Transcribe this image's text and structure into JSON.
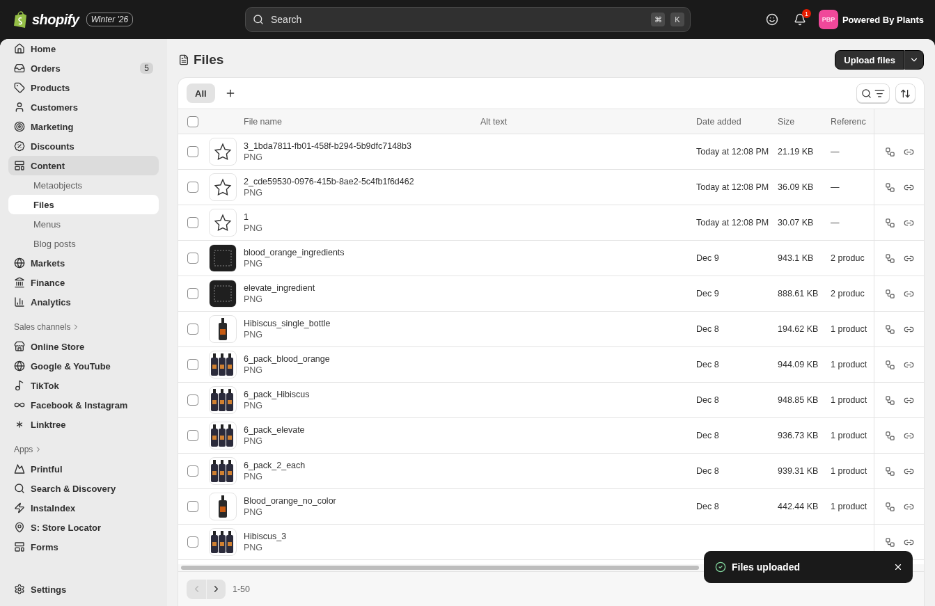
{
  "topbar": {
    "brand": "shopify",
    "edition": "Winter '26",
    "search": {
      "placeholder": "Search",
      "keys": [
        "⌘",
        "K"
      ]
    },
    "notifications": "1",
    "store": {
      "initials": "PBP",
      "name": "Powered By Plants"
    }
  },
  "sidebar": {
    "items": [
      {
        "label": "Home",
        "selected": false,
        "expanded": false
      },
      {
        "label": "Orders",
        "badge": "5",
        "selected": false,
        "expanded": false
      },
      {
        "label": "Products",
        "selected": false,
        "expanded": false
      },
      {
        "label": "Customers",
        "selected": false,
        "expanded": false
      },
      {
        "label": "Marketing",
        "selected": false,
        "expanded": false
      },
      {
        "label": "Discounts",
        "selected": false,
        "expanded": false
      },
      {
        "label": "Content",
        "selected": false,
        "expanded": true,
        "children": [
          {
            "label": "Metaobjects",
            "selected": false
          },
          {
            "label": "Files",
            "selected": true
          },
          {
            "label": "Menus",
            "selected": false
          },
          {
            "label": "Blog posts",
            "selected": false
          }
        ]
      },
      {
        "label": "Markets",
        "selected": false,
        "expanded": false
      },
      {
        "label": "Finance",
        "selected": false,
        "expanded": false
      },
      {
        "label": "Analytics",
        "selected": false,
        "expanded": false
      }
    ],
    "sections": [
      {
        "title": "Sales channels",
        "items": [
          {
            "label": "Online Store"
          },
          {
            "label": "Google & YouTube"
          },
          {
            "label": "TikTok"
          },
          {
            "label": "Facebook & Instagram"
          },
          {
            "label": "Linktree"
          }
        ]
      },
      {
        "title": "Apps",
        "items": [
          {
            "label": "Printful"
          },
          {
            "label": "Search & Discovery"
          },
          {
            "label": "InstaIndex"
          },
          {
            "label": "S: Store Locator"
          },
          {
            "label": "Forms"
          }
        ]
      }
    ],
    "settings": "Settings"
  },
  "page": {
    "title": "Files",
    "upload_button": "Upload files"
  },
  "views": [
    {
      "label": "All",
      "selected": true
    }
  ],
  "table": {
    "all_checked": false,
    "columns": [
      "File name",
      "Alt text",
      "Date added",
      "Size",
      "Referenc"
    ],
    "rows": [
      {
        "kind": "logo",
        "name": "3_1bda7811-fb01-458f-b294-5b9dfc7148b3",
        "type": "PNG",
        "date": "Today at 12:08 PM",
        "size": "21.19 KB",
        "references": "—",
        "checked": false
      },
      {
        "kind": "logo",
        "name": "2_cde59530-0976-415b-8ae2-5c4fb1f6d462",
        "type": "PNG",
        "date": "Today at 12:08 PM",
        "size": "36.09 KB",
        "references": "—",
        "checked": false
      },
      {
        "kind": "logo",
        "name": "1",
        "type": "PNG",
        "date": "Today at 12:08 PM",
        "size": "30.07 KB",
        "references": "—",
        "checked": false
      },
      {
        "kind": "label",
        "name": "blood_orange_ingredients",
        "type": "PNG",
        "date": "Dec 9",
        "size": "943.1 KB",
        "references": "2 produc",
        "checked": false
      },
      {
        "kind": "label",
        "name": "elevate_ingredient",
        "type": "PNG",
        "date": "Dec 9",
        "size": "888.61 KB",
        "references": "2 produc",
        "checked": false
      },
      {
        "kind": "bottle",
        "name": "Hibiscus_single_bottle",
        "type": "PNG",
        "date": "Dec 8",
        "size": "194.62 KB",
        "references": "1 product",
        "checked": false
      },
      {
        "kind": "pack",
        "name": "6_pack_blood_orange",
        "type": "PNG",
        "date": "Dec 8",
        "size": "944.09 KB",
        "references": "1 product",
        "checked": false
      },
      {
        "kind": "pack",
        "name": "6_pack_Hibiscus",
        "type": "PNG",
        "date": "Dec 8",
        "size": "948.85 KB",
        "references": "1 product",
        "checked": false
      },
      {
        "kind": "pack",
        "name": "6_pack_elevate",
        "type": "PNG",
        "date": "Dec 8",
        "size": "936.73 KB",
        "references": "1 product",
        "checked": false
      },
      {
        "kind": "pack",
        "name": "6_pack_2_each",
        "type": "PNG",
        "date": "Dec 8",
        "size": "939.31 KB",
        "references": "1 product",
        "checked": false
      },
      {
        "kind": "bottle",
        "name": "Blood_orange_no_color",
        "type": "PNG",
        "date": "Dec 8",
        "size": "442.44 KB",
        "references": "1 product",
        "checked": false
      },
      {
        "kind": "pack",
        "name": "Hibiscus_3",
        "type": "PNG",
        "checked": false
      }
    ]
  },
  "pagination": {
    "range": "1-50",
    "previous_disabled": true,
    "next_disabled": false
  },
  "toast": {
    "message": "Files uploaded"
  }
}
